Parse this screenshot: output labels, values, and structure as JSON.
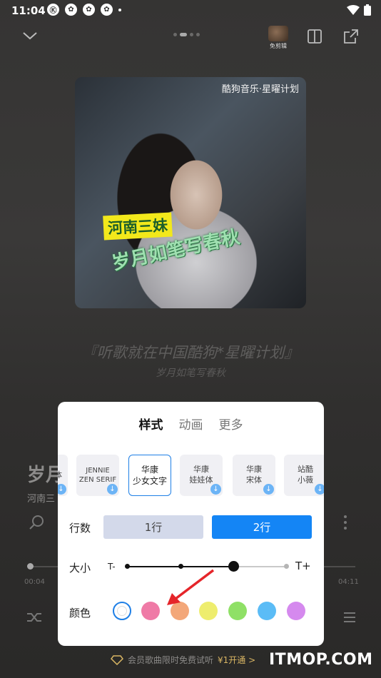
{
  "status_bar": {
    "time": "11:04",
    "app_icons": [
      "Ⓚ",
      "✿",
      "✿",
      "✿"
    ]
  },
  "top_bar": {
    "pager_count": 4,
    "pager_active": 1,
    "avatar_label": "免剪辑"
  },
  "album": {
    "source": "酷狗音乐·星曜计划",
    "title_badge": "河南三妹",
    "title_art": "岁月如笔写春秋"
  },
  "lyrics": {
    "main": "『听歌就在中国酷狗*星曜计划』",
    "sub": "岁月如笔写春秋"
  },
  "song": {
    "title": "岁月",
    "artist": "河南三",
    "time_start": "00:04",
    "time_end": "04:11"
  },
  "panel": {
    "tabs": [
      {
        "label": "样式",
        "active": true
      },
      {
        "label": "动画",
        "active": false
      },
      {
        "label": "更多",
        "active": false
      }
    ],
    "fonts": [
      {
        "label": "体",
        "selected": false,
        "download": true
      },
      {
        "label": "JENNIE\nZEN SERIF",
        "selected": false,
        "download": true
      },
      {
        "label": "华康\n少女文字",
        "selected": true,
        "download": false
      },
      {
        "label": "华康\n娃娃体",
        "selected": false,
        "download": true
      },
      {
        "label": "华康\n宋体",
        "selected": false,
        "download": true
      },
      {
        "label": "站酷\n小薇",
        "selected": false,
        "download": true
      }
    ],
    "rows_label": "行数",
    "rows_options": [
      {
        "label": "1行",
        "active": false
      },
      {
        "label": "2行",
        "active": true
      }
    ],
    "size_label": "大小",
    "size_min": "T-",
    "size_max": "T+",
    "size_level_index": 3,
    "size_levels": 5,
    "color_label": "颜色",
    "colors": [
      "#ffffff",
      "#ef7aa6",
      "#f3a779",
      "#eeed6e",
      "#8fe066",
      "#5bbcf6",
      "#d589ee"
    ],
    "selected_color_index": 0
  },
  "vip_bar": {
    "text": "会员歌曲限时免费试听",
    "cta": "¥1开通 >"
  },
  "watermark": "ITMOP.COM"
}
